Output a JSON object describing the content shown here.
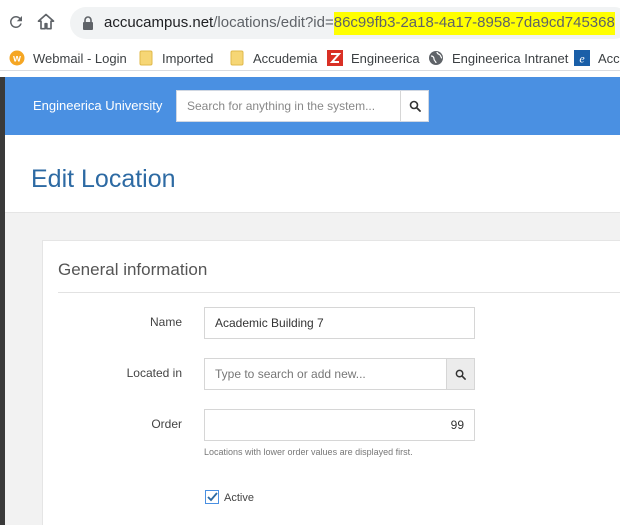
{
  "browser": {
    "url_host": "accucampus.net",
    "url_path": "/locations/edit?id=",
    "url_id": "86c99fb3-2a18-4a17-8958-7da9cd745368",
    "bookmarks": [
      {
        "label": "Webmail - Login",
        "icon": "webmail-icon",
        "color": "#f5a623"
      },
      {
        "label": "Imported",
        "icon": "folder-icon",
        "color": "#f6d675"
      },
      {
        "label": "Accudemia",
        "icon": "folder-icon",
        "color": "#f6d675"
      },
      {
        "label": "Engineerica",
        "icon": "zotero-z-icon",
        "color": "#d93025"
      },
      {
        "label": "Engineerica Intranet",
        "icon": "globe-icon",
        "color": "#5f6368"
      },
      {
        "label": "Accu",
        "icon": "e-logo-icon",
        "color": "#1a5fa8"
      }
    ]
  },
  "app": {
    "brand": "Engineerica University",
    "search_placeholder": "Search for anything in the system..."
  },
  "page": {
    "title": "Edit Location",
    "section_title": "General information"
  },
  "form": {
    "name_label": "Name",
    "name_value": "Academic Building 7",
    "located_label": "Located in",
    "located_placeholder": "Type to search or add new...",
    "order_label": "Order",
    "order_value": "99",
    "order_hint": "Locations with lower order values are displayed first.",
    "active_label": "Active",
    "active_checked": true
  },
  "colors": {
    "header": "#4a90e2",
    "title": "#2d6aa3",
    "highlight": "#ffff00"
  }
}
